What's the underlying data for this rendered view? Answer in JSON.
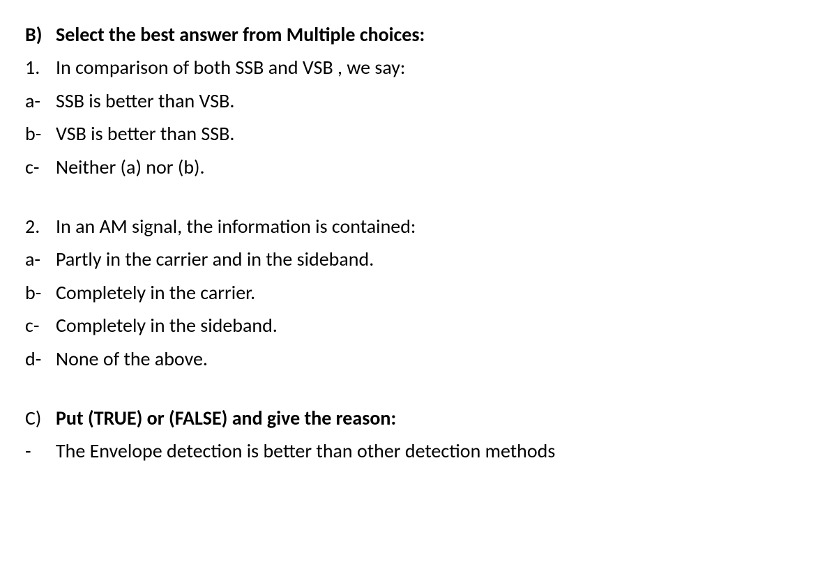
{
  "sectionB": {
    "marker": "B)",
    "heading": "Select the best answer from Multiple choices:",
    "q1": {
      "marker": "1.",
      "text": "In comparison of both SSB and VSB , we say:",
      "a": {
        "marker": "a-",
        "text": "SSB is better than VSB."
      },
      "b": {
        "marker": "b-",
        "text": "VSB is better than SSB."
      },
      "c": {
        "marker": "c-",
        "text": "Neither (a) nor (b)."
      }
    },
    "q2": {
      "marker": "2.",
      "text": "In an AM signal, the information is contained:",
      "a": {
        "marker": "a-",
        "text": "Partly in the carrier and in the sideband."
      },
      "b": {
        "marker": "b-",
        "text": "Completely in the carrier."
      },
      "c": {
        "marker": "c-",
        "text": "Completely in the sideband."
      },
      "d": {
        "marker": "d-",
        "text": "None of the above."
      }
    }
  },
  "sectionC": {
    "marker": "C)",
    "heading": "Put (TRUE) or (FALSE) and give the reason:",
    "item": {
      "marker": "-",
      "text": "The Envelope detection is better than other detection methods"
    }
  }
}
